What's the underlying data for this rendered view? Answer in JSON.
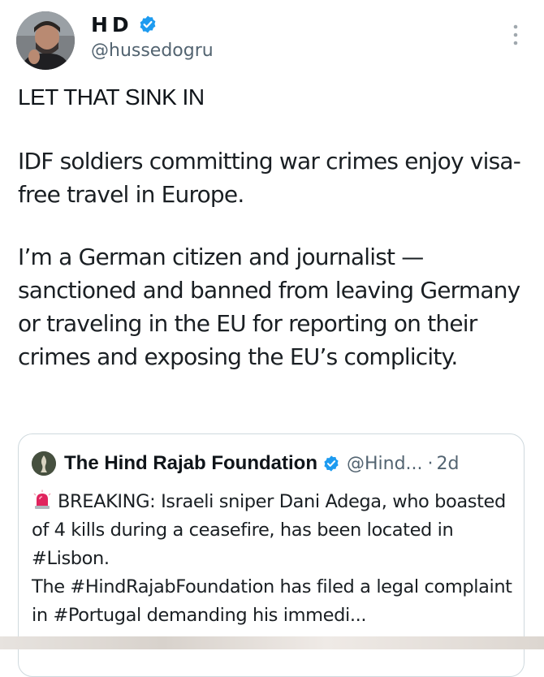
{
  "author": {
    "display_name": "HD",
    "handle": "@hussedogru",
    "verified": true,
    "verified_color": "#1d9bf0"
  },
  "tweet": {
    "headline": "LET THAT SINK IN",
    "paragraphs": [
      "IDF soldiers committing war crimes enjoy visa-free travel in Europe.",
      "I’m a German citizen and journalist — sanctioned and banned from leaving Germany or traveling in the EU for reporting on their crimes and exposing the EU’s complicity."
    ]
  },
  "quoted": {
    "name": "The Hind Rajab Foundation",
    "handle": "@Hind...",
    "dot": "·",
    "time": "2d",
    "verified": true,
    "icon": "siren-icon",
    "line1": "BREAKING: Israeli sniper Dani Adega, who boasted of 4 kills during a ceasefire, has been located in #Lisbon.",
    "line2": "The #HindRajabFoundation has filed a legal complaint in #Portugal demanding his immedi..."
  },
  "colors": {
    "text": "#0f1419",
    "secondary": "#536471",
    "border": "#cfd9de",
    "verified": "#1d9bf0",
    "siren": "#e0245e"
  },
  "icons": [
    "more-icon",
    "verified-icon",
    "siren-icon"
  ]
}
